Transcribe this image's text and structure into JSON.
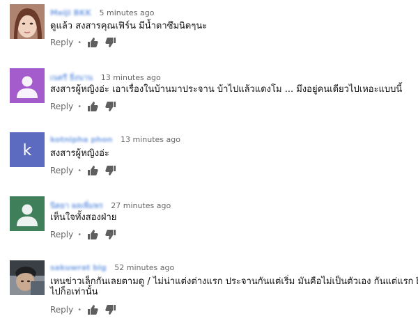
{
  "comments": [
    {
      "author": "Meiji BKK",
      "time": "5 minutes ago",
      "text": [
        "ดูแล้ว  สงสารคุณเฟิร์น  มีน้ำตาซึมนิดๆนะ"
      ],
      "reply_label": "Reply",
      "avatar": {
        "type": "photo",
        "bg": "#c9a48f"
      }
    },
    {
      "author": "เนตรี ยิ่งนาน",
      "time": "13 minutes ago",
      "text": [
        "สงสารผู้หญิงอ่ะ เอาเรื่องในบ้านมาประจาน บ้าไปแล้วแดงโม ... มึงอยู่คนเดียวไปเหอะแบบนี้"
      ],
      "reply_label": "Reply",
      "avatar": {
        "type": "person",
        "bg": "#a45ccc"
      }
    },
    {
      "author": "kotnipha phon",
      "time": "13 minutes ago",
      "text": [
        "สงสารผู้หญิงอ่ะ"
      ],
      "reply_label": "Reply",
      "avatar": {
        "type": "letter",
        "letter": "k",
        "bg": "#5c6bc0"
      }
    },
    {
      "author": "นิตยา ผลเพิ่มพร",
      "time": "27 minutes ago",
      "text": [
        "เห็นใจทั้งสองฝ่าย"
      ],
      "reply_label": "Reply",
      "avatar": {
        "type": "person",
        "bg": "#3f7f5a"
      }
    },
    {
      "author": "sakuwrat big",
      "time": "52 minutes ago",
      "text": [
        "เหนข่าวเล็กกันเลยตามดู / ไม่น่าแต่งต่างแรก ประจานกันแต่เริ่ม  มันคือไม่เป็นตัวเอง กันแต่แรก ฝืน",
        "ไปก็อเท่านั้น"
      ],
      "reply_label": "Reply",
      "avatar": {
        "type": "photo",
        "bg": "#4a5560"
      }
    }
  ],
  "colors": {
    "author": "#7fa6e6",
    "meta": "#666666",
    "icon": "#5f5f5f"
  },
  "icons": {
    "like": "thumbs-up-icon",
    "dislike": "thumbs-down-icon"
  }
}
